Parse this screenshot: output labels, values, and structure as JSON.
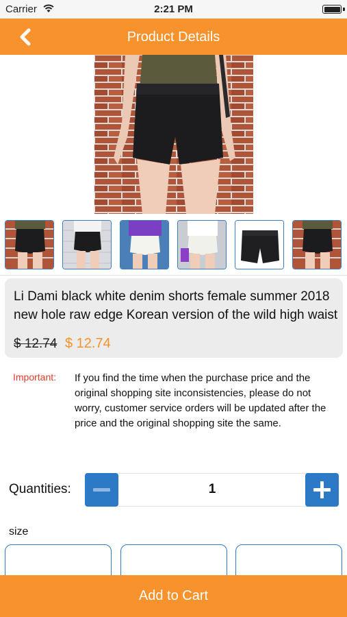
{
  "status_bar": {
    "carrier": "Carrier",
    "time": "2:21 PM",
    "battery_level": 1.0
  },
  "nav": {
    "title": "Product Details",
    "back_icon": "chevron-left-icon"
  },
  "product": {
    "title": "Li Dami black white denim shorts female summer 2018 new hole raw edge Korean version of the wild high waist",
    "price_original": "$ 12.74",
    "price_current": "$ 12.74",
    "thumbnails": [
      "black-shorts-brick-wall",
      "black-shorts-white-wall",
      "white-shorts-purple-top",
      "white-shorts-white-tee",
      "black-shorts-flatlay",
      "black-shorts-brick-wall-2"
    ]
  },
  "notice": {
    "label": "Important:",
    "text": "If you find the time when the purchase price and the original shopping site inconsistencies, please do not worry, customer service orders will be updated after the price and the original shopping site the same."
  },
  "quantity": {
    "label": "Quantities:",
    "value": "1",
    "minus_icon": "minus-icon",
    "plus_icon": "plus-icon"
  },
  "size": {
    "label": "size"
  },
  "cart": {
    "label": "Add to Cart"
  },
  "colors": {
    "accent": "#f7922c",
    "button_blue": "#2c79c5",
    "important_red": "#e23b2b"
  }
}
